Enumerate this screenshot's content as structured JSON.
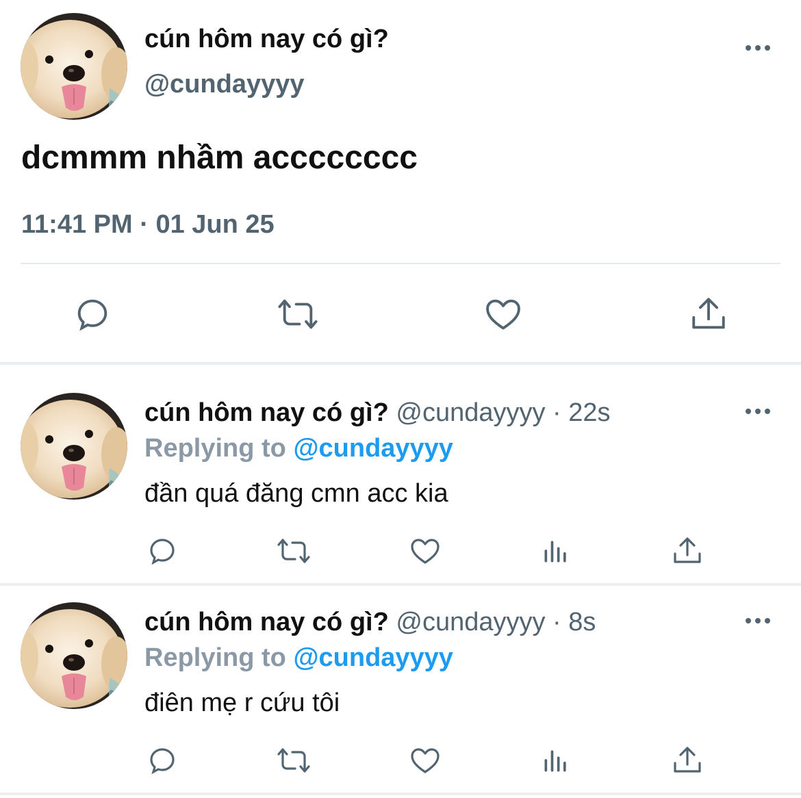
{
  "main_tweet": {
    "display_name": "cún hôm nay có gì?",
    "handle": "@cundayyyy",
    "text": "dcmmm nhầm acccccccc",
    "time": "11:41 PM",
    "dot": "·",
    "date": "01 Jun 25"
  },
  "replies": [
    {
      "display_name": "cún hôm nay có gì?",
      "meta": " @cundayyyy · 22s",
      "replying_label": "Replying to ",
      "replying_to": "@cundayyyy",
      "text": "đần quá đăng cmn acc kia"
    },
    {
      "display_name": "cún hôm nay có gì?",
      "meta": " @cundayyyy · 8s",
      "replying_label": "Replying to ",
      "replying_to": "@cundayyyy",
      "text": "điên mẹ r cứu tôi"
    }
  ],
  "icons": {
    "reply": "speech-bubble-icon",
    "retweet": "retweet-icon",
    "like": "heart-icon",
    "views": "bar-chart-icon",
    "share": "share-icon",
    "more": "more-horizontal-icon"
  },
  "colors": {
    "link": "#1d9bf0",
    "muted": "#536471",
    "text": "#0f1419"
  }
}
